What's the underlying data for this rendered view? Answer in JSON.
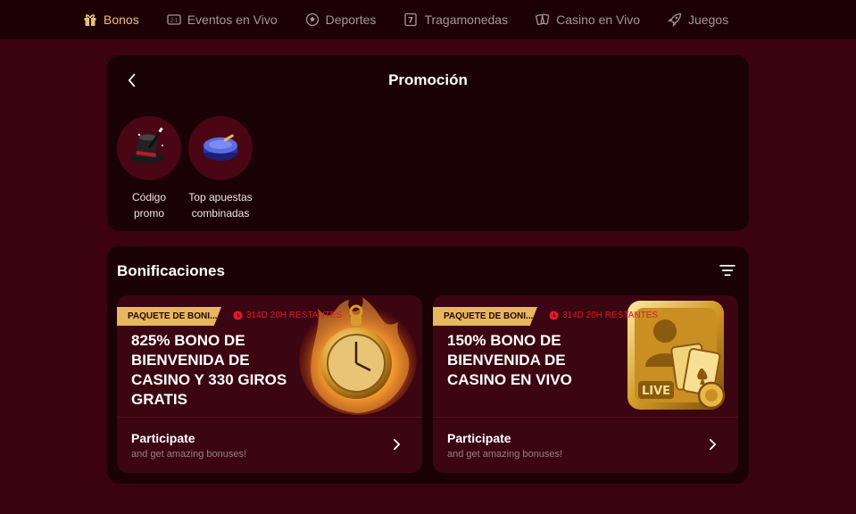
{
  "nav": {
    "items": [
      {
        "label": "Bonos",
        "icon": "gift-icon",
        "active": true
      },
      {
        "label": "Eventos en Vivo",
        "icon": "scoreboard-icon",
        "active": false
      },
      {
        "label": "Deportes",
        "icon": "soccer-ball-icon",
        "active": false
      },
      {
        "label": "Tragamonedas",
        "icon": "slot-seven-icon",
        "active": false
      },
      {
        "label": "Casino en Vivo",
        "icon": "playing-cards-icon",
        "active": false
      },
      {
        "label": "Juegos",
        "icon": "rocket-icon",
        "active": false
      }
    ]
  },
  "promo": {
    "title": "Promoción",
    "items": [
      {
        "label_line1": "Código",
        "label_line2": "promo",
        "icon": "magic-hat-icon"
      },
      {
        "label_line1": "Top apuestas",
        "label_line2": "combinadas",
        "icon": "hockey-puck-icon"
      }
    ]
  },
  "bonus": {
    "heading": "Bonificaciones",
    "cards": [
      {
        "tag": "PAQUETE DE BONI...",
        "timer": "314D 20H RESTANTES",
        "title": "825% BONO DE BIENVENIDA DE CASINO Y 330 GIROS GRATIS",
        "cta": "Participate",
        "sub": "and get amazing bonuses!",
        "art": "flaming-pocket-watch-icon"
      },
      {
        "tag": "PAQUETE DE BONI...",
        "timer": "314D 20H RESTANTES",
        "title": "150% BONO DE BIENVENIDA DE CASINO EN VIVO",
        "cta": "Participate",
        "sub": "and get amazing bonuses!",
        "art": "live-dealer-cards-icon",
        "art_text": "LIVE"
      }
    ]
  },
  "colors": {
    "background": "#3a030f",
    "panel": "#1a0206",
    "card": "#3b0512",
    "accent_gold": "#e6b75c",
    "timer_red": "#e01b2a"
  }
}
